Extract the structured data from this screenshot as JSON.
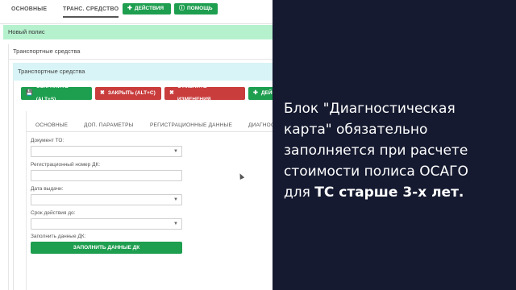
{
  "top_tabs": [
    "ОСНОВНЫЕ",
    "ТРАНС. СРЕДСТВО"
  ],
  "top_buttons": {
    "actions": {
      "icon": "✚",
      "label": "ДЕЙСТВИЯ"
    },
    "help": {
      "icon": "ⓘ",
      "label": "ПОМОЩЬ"
    }
  },
  "banner": "Новый полис",
  "section1_title": "Транспортные средства",
  "section2_title": "Транспортные средства",
  "action_buttons": [
    {
      "icon": "💾",
      "label": "СОХРАНИТЬ (ALT+S)",
      "color": "#1e9e4f"
    },
    {
      "icon": "✖",
      "label": "ЗАКРЫТЬ (ALT+C)",
      "color": "#c93d3d"
    },
    {
      "icon": "✖",
      "label": "ОТМЕНИТЬ ИЗМЕНЕНИЯ",
      "color": "#c93d3d"
    },
    {
      "icon": "✚",
      "label": "ДЕЙСТВ",
      "color": "#1e9e4f"
    }
  ],
  "sub_tabs": [
    "ОСНОВНЫЕ",
    "ДОП. ПАРАМЕТРЫ",
    "РЕГИСТРАЦИОННЫЕ ДАННЫЕ",
    "ДИАГНОС"
  ],
  "form": {
    "doc_to_label": "Документ ТО:",
    "reg_number_label": "Регистрационный номер ДК:",
    "issue_date_label": "Дата выдачи:",
    "valid_until_label": "Срок действия до:",
    "fill_dk_label": "Заполнить данные ДК:",
    "fill_dk_button": "ЗАПОЛНИТЬ ДАННЫЕ ДК"
  },
  "overlay": {
    "line1": "Блок \"Диагностическая",
    "line2": "карта\" обязательно",
    "line3": "заполняется при расчете",
    "line4": "стоимости полиса ОСАГО",
    "line5_prefix": "для ",
    "line5_bold": "ТС старше 3-х лет."
  },
  "colors": {
    "accent_green": "#1e9e4f",
    "danger_red": "#c93d3d",
    "banner_green": "#b6f1ce",
    "overlay_bg": "#151a30"
  }
}
